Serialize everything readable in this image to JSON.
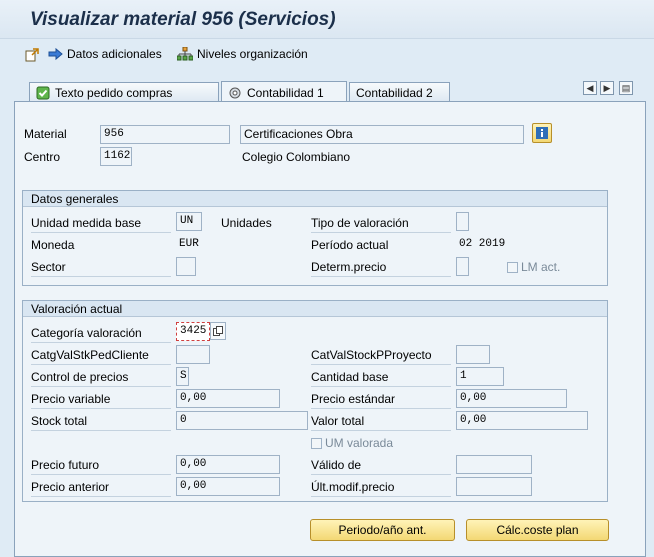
{
  "window": {
    "title": "Visualizar material 956 (Servicios)"
  },
  "toolbar": {
    "additional_data_label": "Datos adicionales",
    "org_levels_label": "Niveles organización"
  },
  "tabs": [
    {
      "label": "Texto pedido compras"
    },
    {
      "label": "Contabilidad 1"
    },
    {
      "label": "Contabilidad 2"
    }
  ],
  "header": {
    "material_label": "Material",
    "material_value": "956",
    "material_desc": "Certificaciones Obra",
    "center_label": "Centro",
    "center_value": "1162",
    "center_desc": "Colegio Colombiano"
  },
  "general_data": {
    "title": "Datos generales",
    "base_unit_label": "Unidad medida base",
    "base_unit_value": "UN",
    "base_unit_text": "Unidades",
    "valuation_type_label": "Tipo de valoración",
    "valuation_type_value": "",
    "currency_label": "Moneda",
    "currency_value": "EUR",
    "current_period_label": "Período actual",
    "current_period_value": "02 2019",
    "sector_label": "Sector",
    "sector_value": "",
    "price_determ_label": "Determ.precio",
    "price_determ_value": "",
    "lm_act_label": "LM act."
  },
  "current_valuation": {
    "title": "Valoración actual",
    "valuation_class_label": "Categoría valoración",
    "valuation_class_value": "3425",
    "vc_sales_stock_label": "CatgValStkPedCliente",
    "vc_sales_stock_value": "",
    "vc_project_stock_label": "CatValStockPProyecto",
    "vc_project_stock_value": "",
    "price_control_label": "Control de precios",
    "price_control_value": "S",
    "price_unit_label": "Cantidad base",
    "price_unit_value": "1",
    "moving_price_label": "Precio variable",
    "moving_price_value": "0,00",
    "standard_price_label": "Precio estándar",
    "standard_price_value": "0,00",
    "total_stock_label": "Stock total",
    "total_stock_value": "0",
    "total_value_label": "Valor total",
    "total_value_value": "0,00",
    "um_valued_label": "UM valorada",
    "future_price_label": "Precio futuro",
    "future_price_value": "0,00",
    "valid_from_label": "Válido de",
    "valid_from_value": "",
    "previous_price_label": "Precio anterior",
    "previous_price_value": "0,00",
    "last_change_label": "Últ.modif.precio",
    "last_change_value": ""
  },
  "buttons": {
    "prev_period_label": "Periodo/año ant.",
    "cost_estimate_label": "Cálc.coste plan"
  }
}
